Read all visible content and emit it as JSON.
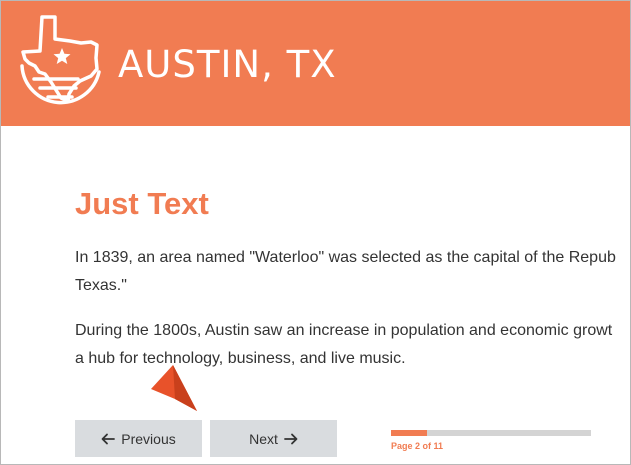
{
  "header": {
    "title": "AUSTIN, TX",
    "logo_icon": "texas-star-sun-logo-icon",
    "background_color": "#f17c52"
  },
  "main": {
    "heading": "Just Text",
    "paragraphs": [
      {
        "line1": "In 1839, an area named \"Waterloo\" was selected as the capital of the Repub",
        "line2": "Texas.\""
      },
      {
        "line1": "During the 1800s, Austin saw an increase in population and economic growt",
        "line2": "a hub for technology, business, and live music."
      }
    ]
  },
  "navigation": {
    "previous_label": "Previous",
    "previous_icon": "arrow-left-icon",
    "next_label": "Next",
    "next_icon": "arrow-right-icon"
  },
  "progress": {
    "label": "Page 2 of 11",
    "current_page": 2,
    "total_pages": 11,
    "accent_color": "#f17c52"
  },
  "pointer": {
    "icon": "arrow-pointer-icon",
    "color": "#e8522a"
  }
}
